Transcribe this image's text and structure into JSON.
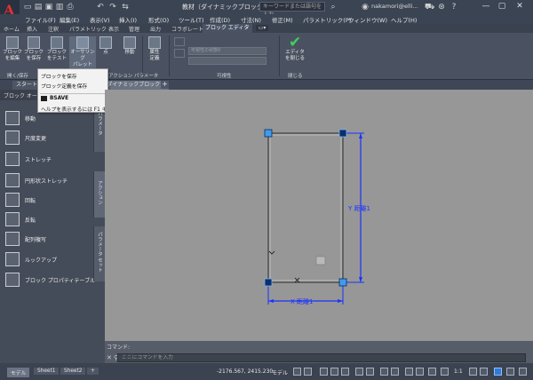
{
  "titlebar": {
    "logo": "A",
    "title": "教材（ダイナミックブロック）.dwg",
    "search_placeholder": "キーワードまたは語句を入力",
    "user": "nakamori@elli...",
    "icons": [
      "folder-open-icon",
      "save-icon",
      "undo-icon",
      "redo-icon",
      "share-icon"
    ]
  },
  "menubar": {
    "items": [
      "ファイル(F)",
      "編集(E)",
      "表示(V)",
      "挿入(I)",
      "形式(O)",
      "ツール(T)",
      "作成(D)",
      "寸法(N)",
      "修正(M)",
      "パラメトリック(P)",
      "ウィンドウ(W)",
      "ヘルプ(H)"
    ]
  },
  "ribbon_tabs": {
    "items": [
      "ホーム",
      "挿入",
      "注釈",
      "パラメトリック",
      "表示",
      "管理",
      "出力",
      "コラボレート",
      "ブロック エディタ"
    ],
    "active_index": 8
  },
  "ribbon": {
    "buttons": [
      {
        "label1": "ブロック",
        "label2": "を編集"
      },
      {
        "label1": "ブロック",
        "label2": "を保存"
      },
      {
        "label1": "ブロック",
        "label2": "をテスト"
      },
      {
        "label1": "オーサリング",
        "label2": "パレット"
      },
      {
        "label1": "点",
        "label2": ""
      },
      {
        "label1": "移動",
        "label2": ""
      },
      {
        "label1": "属性",
        "label2": "定義"
      },
      {
        "label1": "エディタ",
        "label2": "を閉じる"
      }
    ],
    "field1": "可視性の状態0",
    "field2": "",
    "panels": [
      "開く/保存",
      "アクション パラメータ",
      "可視性",
      "閉じる"
    ]
  },
  "dropdown": {
    "items": [
      "ブロックを保存",
      "ブロック定義を保存",
      "BSAVE",
      "ヘルプを表示するには F1 キー"
    ]
  },
  "filetabs": {
    "start": "スタート",
    "doc": "(ダイナミックブロック)*"
  },
  "palette": {
    "header": "ブロック オーサ...",
    "items": [
      "移動",
      "尺度変更",
      "ストレッチ",
      "円形状ストレッチ",
      "回転",
      "反転",
      "配列複写",
      "ルックアップ",
      "ブロック プロパティテーブル"
    ],
    "vtabs": [
      "パラメータ",
      "アクション",
      "パラメータ セット"
    ]
  },
  "canvas": {
    "label_y": "Y 距離1",
    "label_x": "X 距離1"
  },
  "command": {
    "history": "コマンド:",
    "placeholder": "ここにコマンドを入力"
  },
  "statusbar": {
    "tabs": [
      "モデル",
      "Sheet1",
      "Sheet2"
    ],
    "coords": "-2176.567, 2415.230",
    "model": "モデル",
    "scale": "1:1"
  },
  "colors": {
    "accent": "#2f7bd6",
    "grip": "#1e6fd8",
    "dim": "#1a33ff"
  }
}
